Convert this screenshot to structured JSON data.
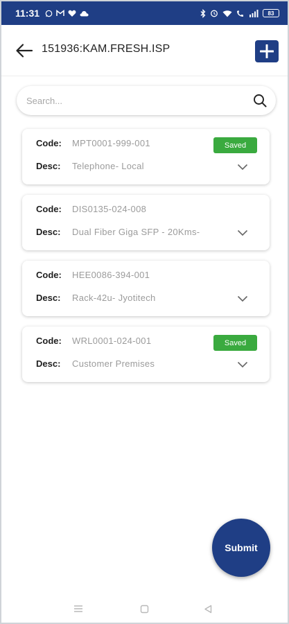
{
  "status_bar": {
    "time": "11:31",
    "battery": "83",
    "left_icons": [
      "whatsapp-icon",
      "gmail-icon",
      "heart-icon",
      "cloud-icon"
    ],
    "right_icons": [
      "bluetooth-icon",
      "alarm-icon",
      "wifi-icon",
      "volte-icon",
      "signal-icon",
      "battery-icon"
    ]
  },
  "header": {
    "title": "151936:KAM.FRESH.ISP",
    "back_icon": "arrow-left-icon",
    "add_icon": "plus-icon"
  },
  "search": {
    "placeholder": "Search...",
    "value": "",
    "icon": "search-icon"
  },
  "labels": {
    "code": "Code:",
    "desc": "Desc:"
  },
  "items": [
    {
      "code": "MPT0001-999-001",
      "desc": "Telephone- Local",
      "status": "Saved"
    },
    {
      "code": "DIS0135-024-008",
      "desc": "Dual Fiber Giga SFP - 20Kms-",
      "status": ""
    },
    {
      "code": "HEE0086-394-001",
      "desc": "Rack-42u- Jyotitech",
      "status": ""
    },
    {
      "code": "WRL0001-024-001",
      "desc": "Customer Premises",
      "status": "Saved"
    }
  ],
  "submit_label": "Submit",
  "colors": {
    "primary": "#1f3e85",
    "saved_badge": "#3aaa3f",
    "value_text": "#9b9b9b"
  },
  "nav": [
    "menu-icon",
    "home-square-icon",
    "back-triangle-icon"
  ]
}
